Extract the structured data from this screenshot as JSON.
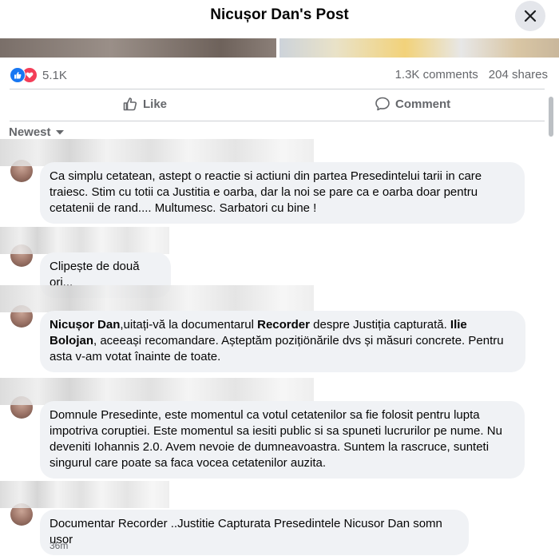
{
  "header": {
    "title": "Nicușor Dan's Post"
  },
  "post": {
    "reaction_count": "5.1K",
    "comments_count": "1.3K comments",
    "shares_count": "204 shares",
    "like_label": "Like",
    "comment_label": "Comment",
    "sort_label": "Newest"
  },
  "comments": [
    {
      "text": "Ca simplu cetatean, astept o reactie si actiuni din partea Presedintelui tarii in care traiesc. Stim cu totii ca Justitia e oarba, dar la noi se pare ca e oarba doar pentru cetatenii de rand.... Multumesc. Sarbatori cu bine !"
    },
    {
      "text": "Clipește de două ori..."
    },
    {
      "mention1": "Nicușor Dan",
      "part1": ",uitați-vă la documentarul ",
      "mention2": "Recorder",
      "part2": " despre Justiția capturată. ",
      "mention3": "Ilie Bolojan",
      "part3": ", aceeași recomandare. Așteptăm pozițiönările dvs și măsuri concrete. Pentru asta v-am votat înainte de toate."
    },
    {
      "text": "Domnule Presedinte, este momentul ca votul cetatenilor sa fie folosit pentru lupta impotriva coruptiei. Este momentul sa iesiti public si sa spuneti lucrurilor pe nume. Nu deveniti Iohannis 2.0. Avem nevoie de dumneavoastra. Suntem la rascruce, sunteti singurul care poate sa faca vocea cetatenilor auzita."
    },
    {
      "text": "Documentar Recorder ..Justitie Capturata Presedintele Nicusor Dan somn usor",
      "time": "36m"
    }
  ],
  "colors": {
    "bubble": "#f0f2f5",
    "secondary_text": "#65676b",
    "like_blue": "#1877f2",
    "love_red": "#f33e58"
  },
  "icons": [
    "close-icon",
    "like-reaction-icon",
    "love-reaction-icon",
    "thumbs-up-icon",
    "comment-icon",
    "caret-down-icon"
  ]
}
